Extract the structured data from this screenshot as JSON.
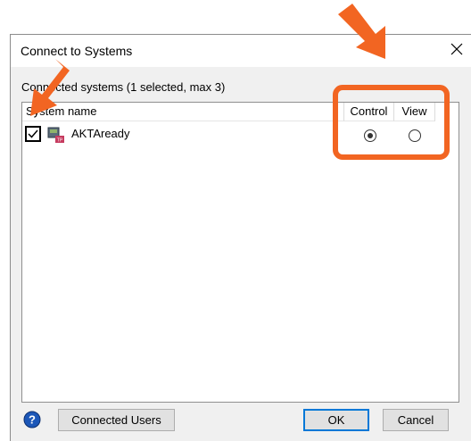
{
  "dialog": {
    "title": "Connect to Systems",
    "group_label": "Connected systems (1 selected, max 3)",
    "columns": {
      "name": "System name",
      "control": "Control",
      "view": "View"
    },
    "systems": [
      {
        "name": "AKTAready",
        "checked": true,
        "mode": "Control"
      }
    ],
    "buttons": {
      "connected_users": "Connected Users",
      "ok": "OK",
      "cancel": "Cancel"
    }
  },
  "colors": {
    "annotation": "#f26522",
    "focus": "#0078d7",
    "help": "#1c57b8"
  },
  "icons": [
    "close-icon",
    "system-icon",
    "help-icon",
    "arrow-icon"
  ]
}
